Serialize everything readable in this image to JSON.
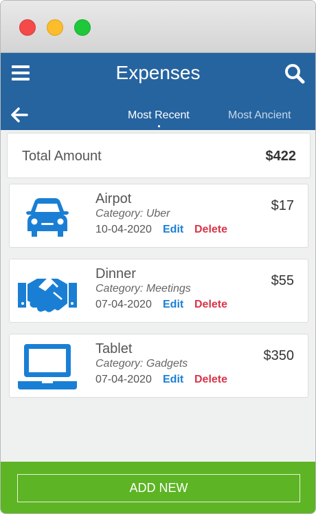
{
  "app": {
    "title": "Expenses"
  },
  "tabs": [
    {
      "label": "Most Recent",
      "active": true
    },
    {
      "label": "Most Ancient",
      "active": false
    }
  ],
  "summary": {
    "label": "Total Amount",
    "value": "$422"
  },
  "expenses": [
    {
      "name": "Airpot",
      "category": "Category: Uber",
      "date": "10-04-2020",
      "amount": "$17",
      "icon": "car-icon",
      "edit_label": "Edit",
      "delete_label": "Delete"
    },
    {
      "name": "Dinner",
      "category": "Category: Meetings",
      "date": "07-04-2020",
      "amount": "$55",
      "icon": "handshake-icon",
      "edit_label": "Edit",
      "delete_label": "Delete"
    },
    {
      "name": "Tablet",
      "category": "Category: Gadgets",
      "date": "07-04-2020",
      "amount": "$350",
      "icon": "laptop-icon",
      "edit_label": "Edit",
      "delete_label": "Delete"
    }
  ],
  "footer": {
    "add_label": "ADD NEW"
  },
  "colors": {
    "header": "#2664a0",
    "accent_blue": "#1a7fd4",
    "delete_red": "#d93448",
    "footer_green": "#5db424"
  }
}
